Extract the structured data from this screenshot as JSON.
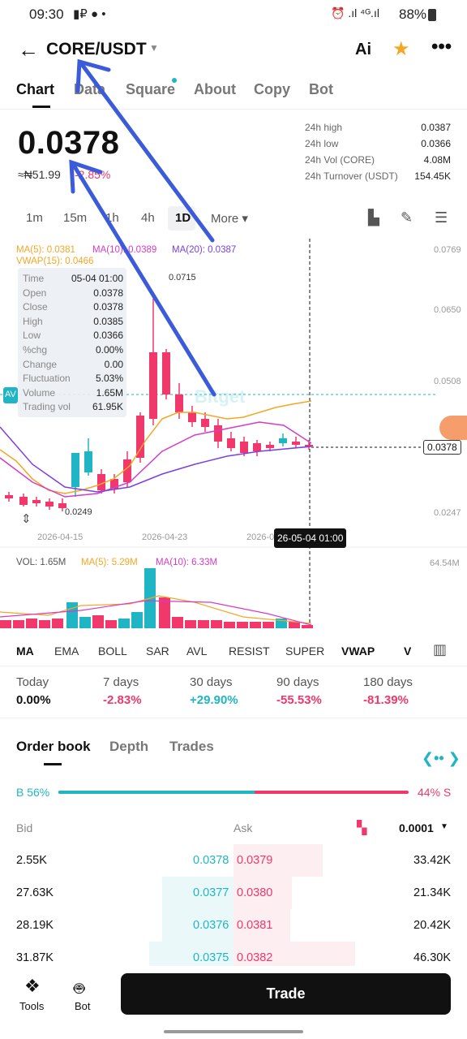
{
  "status": {
    "time": "09:30",
    "battery": "88%"
  },
  "header": {
    "pair": "CORE/USDT",
    "ai": "Ai"
  },
  "tabs": [
    "Chart",
    "Data",
    "Square",
    "About",
    "Copy",
    "Bot"
  ],
  "price": {
    "last": "0.0378",
    "fiat": "≈₦51.99",
    "change": "-2.85%"
  },
  "stats": [
    {
      "label": "24h high",
      "value": "0.0387"
    },
    {
      "label": "24h low",
      "value": "0.0366"
    },
    {
      "label": "24h Vol (CORE)",
      "value": "4.08M"
    },
    {
      "label": "24h Turnover (USDT)",
      "value": "154.45K"
    }
  ],
  "timeframes": [
    "1m",
    "15m",
    "1h",
    "4h",
    "1D",
    "More ▾"
  ],
  "ma_legend": {
    "ma5": "MA(5): 0.0381",
    "ma10": "MA(10): 0.0389",
    "ma20": "MA(20): 0.0387",
    "vwap": "VWAP(15): 0.0466"
  },
  "tooltip": [
    {
      "k": "Time",
      "v": "05-04 01:00"
    },
    {
      "k": "Open",
      "v": "0.0378"
    },
    {
      "k": "Close",
      "v": "0.0378"
    },
    {
      "k": "High",
      "v": "0.0385"
    },
    {
      "k": "Low",
      "v": "0.0366"
    },
    {
      "k": "%chg",
      "v": "0.00%"
    },
    {
      "k": "Change",
      "v": "0.00"
    },
    {
      "k": "Fluctuation",
      "v": "5.03%"
    },
    {
      "k": "Volume",
      "v": "1.65M"
    },
    {
      "k": "Trading vol",
      "v": "61.95K"
    }
  ],
  "price_axis": [
    "0.0769",
    "0.0650",
    "0.0508",
    "0.0378",
    "0.0247"
  ],
  "date_axis": [
    "2026-04-15",
    "2026-04-23",
    "2026-0"
  ],
  "crosshair_time": "26-05-04 01:00",
  "peak_label": "0.0715",
  "low_label": "0.0249",
  "vol_legend": {
    "vol": "VOL: 1.65M",
    "ma5": "MA(5): 5.29M",
    "ma10": "MA(10): 6.33M",
    "max": "64.54M"
  },
  "indicators": [
    "MA",
    "EMA",
    "BOLL",
    "SAR",
    "AVL",
    "RESIST",
    "SUPER",
    "VWAP",
    "V"
  ],
  "performance": [
    {
      "label": "Today",
      "value": "0.00%"
    },
    {
      "label": "7 days",
      "value": "-2.83%"
    },
    {
      "label": "30 days",
      "value": "+29.90%"
    },
    {
      "label": "90 days",
      "value": "-55.53%"
    },
    {
      "label": "180 days",
      "value": "-81.39%"
    }
  ],
  "orderbook_tabs": [
    "Order book",
    "Depth",
    "Trades"
  ],
  "ratio": {
    "buy": "B 56%",
    "sell": "44% S",
    "buy_fraction": 0.56
  },
  "ob_header": {
    "bid": "Bid",
    "ask": "Ask",
    "precision": "0.0001"
  },
  "orders": [
    {
      "bid_qty": "2.55K",
      "bid": "0.0378",
      "ask": "0.0379",
      "ask_qty": "33.42K"
    },
    {
      "bid_qty": "27.63K",
      "bid": "0.0377",
      "ask": "0.0380",
      "ask_qty": "21.34K"
    },
    {
      "bid_qty": "28.19K",
      "bid": "0.0376",
      "ask": "0.0381",
      "ask_qty": "20.42K"
    },
    {
      "bid_qty": "31.87K",
      "bid": "0.0375",
      "ask": "0.0382",
      "ask_qty": "46.30K"
    }
  ],
  "bottom": {
    "tools": "Tools",
    "bot": "Bot",
    "trade": "Trade"
  },
  "colors": {
    "up": "#1fb5c4",
    "down": "#f0386b",
    "ma5": "#f5a623",
    "ma10": "#d63bc8",
    "ma20": "#7b3fe4",
    "annotation": "#3b5bdb"
  }
}
